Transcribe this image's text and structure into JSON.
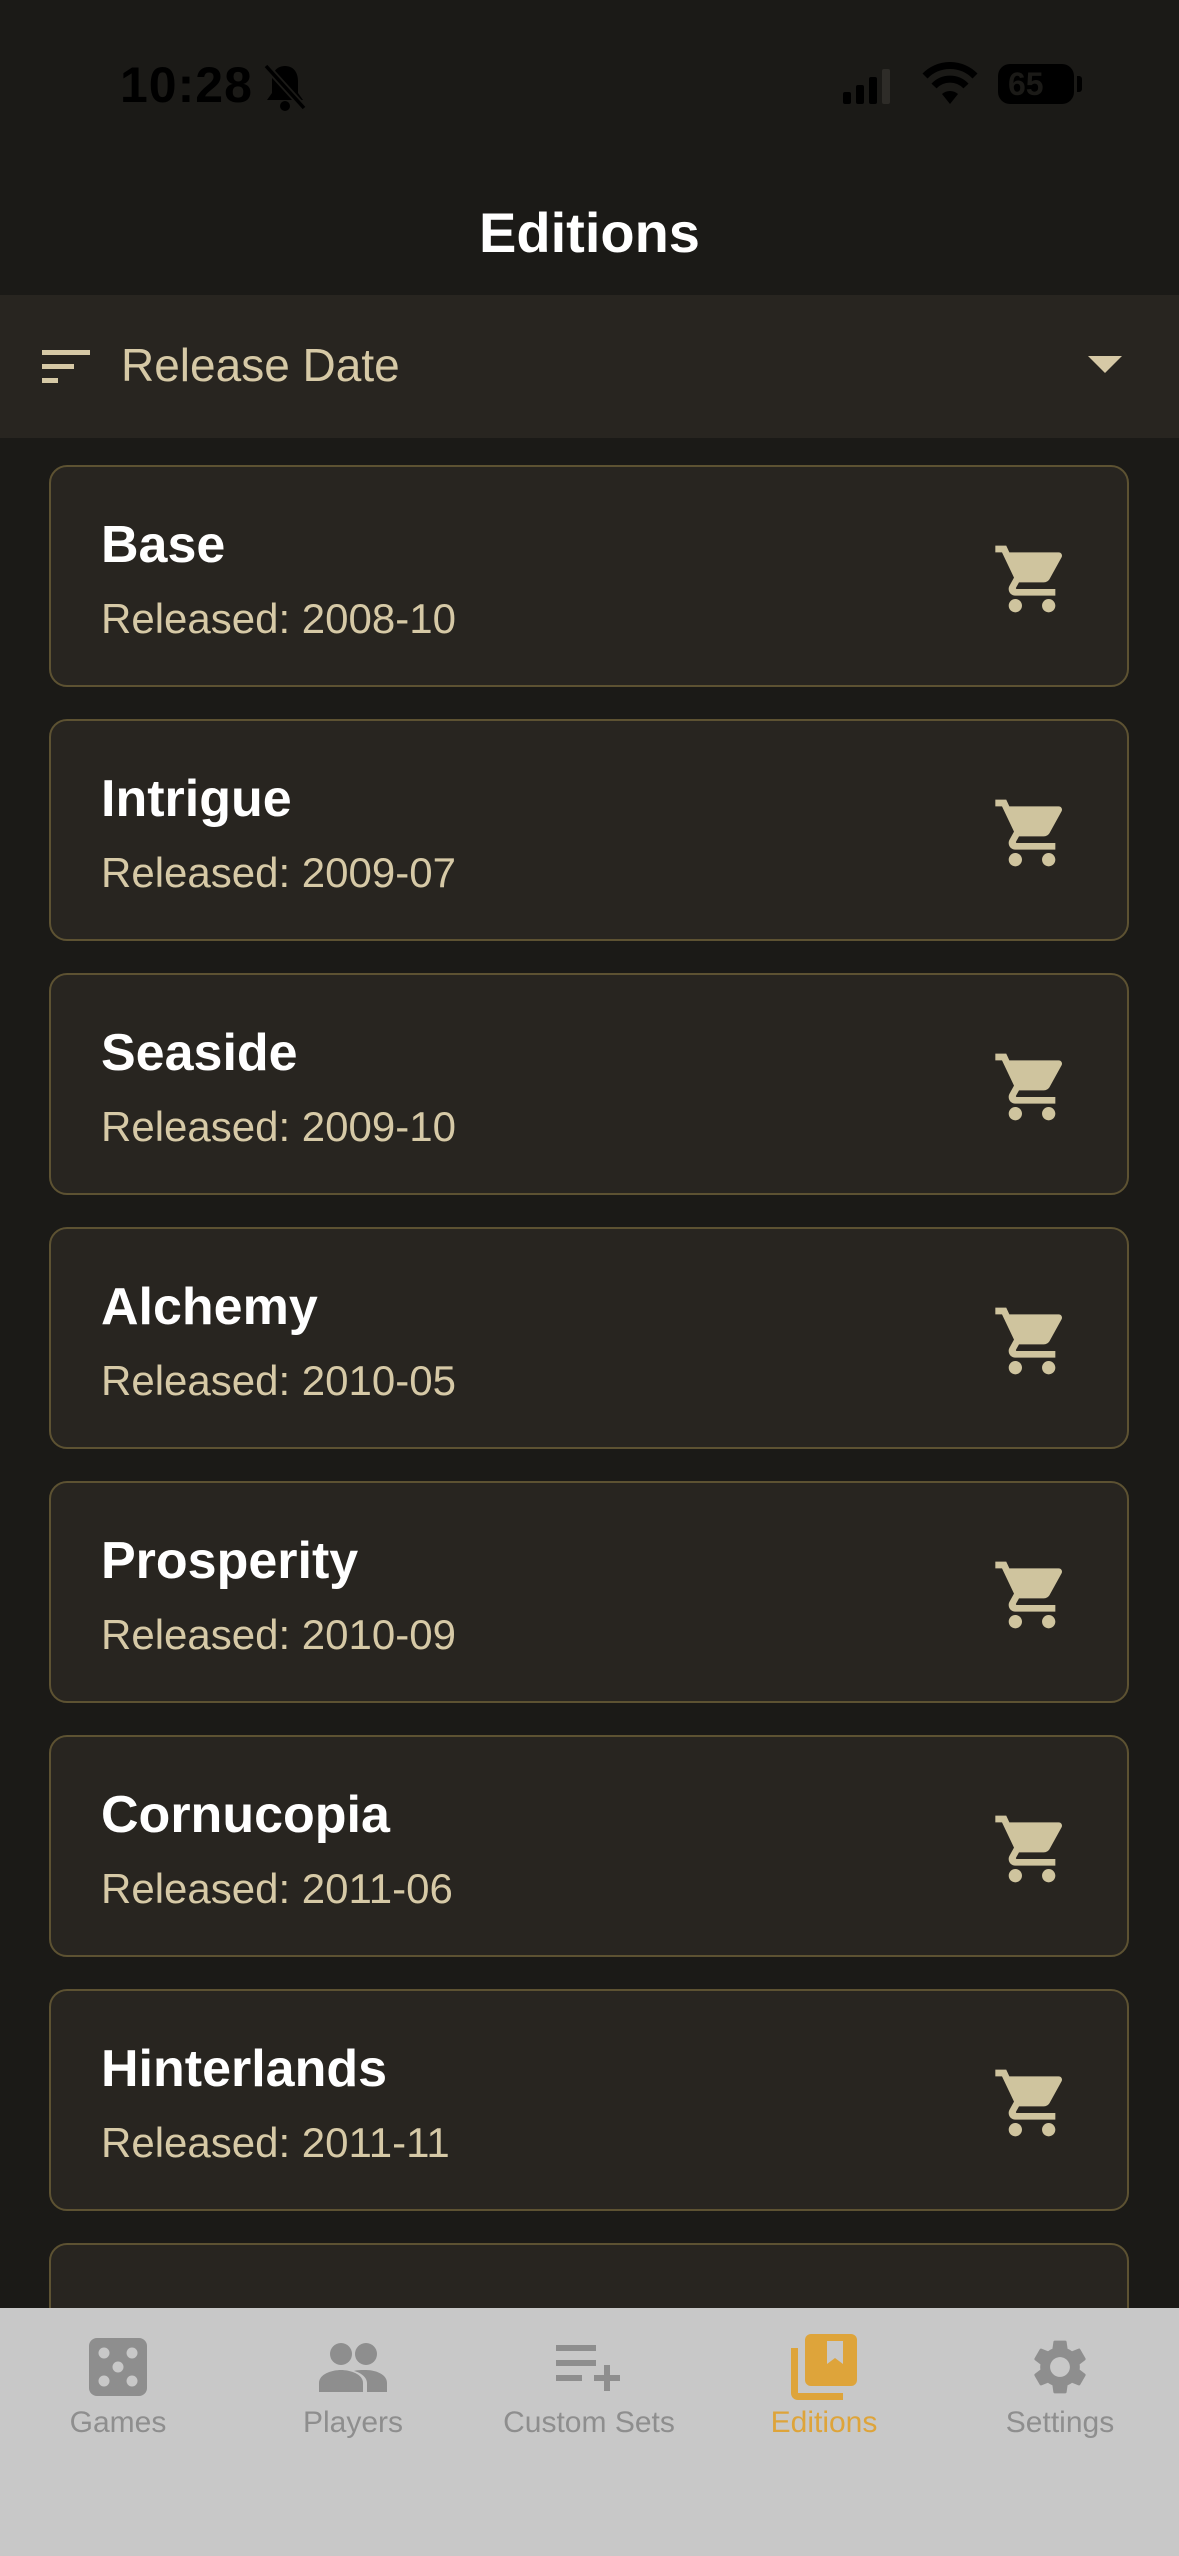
{
  "status_bar": {
    "time": "10:28",
    "battery": "65"
  },
  "header": {
    "title": "Editions"
  },
  "sort": {
    "label": "Release Date"
  },
  "editions": [
    {
      "name": "Base",
      "released": "Released: 2008-10"
    },
    {
      "name": "Intrigue",
      "released": "Released: 2009-07"
    },
    {
      "name": "Seaside",
      "released": "Released: 2009-10"
    },
    {
      "name": "Alchemy",
      "released": "Released: 2010-05"
    },
    {
      "name": "Prosperity",
      "released": "Released: 2010-09"
    },
    {
      "name": "Cornucopia",
      "released": "Released: 2011-06"
    },
    {
      "name": "Hinterlands",
      "released": "Released: 2011-11"
    }
  ],
  "tabs": [
    {
      "label": "Games",
      "icon": "dice-icon"
    },
    {
      "label": "Players",
      "icon": "people-icon"
    },
    {
      "label": "Custom Sets",
      "icon": "playlist-add-icon"
    },
    {
      "label": "Editions",
      "icon": "library-books-icon",
      "active": true
    },
    {
      "label": "Settings",
      "icon": "gear-icon"
    }
  ],
  "colors": {
    "background": "#1b1a17",
    "card": "#282520",
    "accent": "#dea43a",
    "secondary_text": "#d6c9a6",
    "tab_bar": "#c8c8c8"
  }
}
